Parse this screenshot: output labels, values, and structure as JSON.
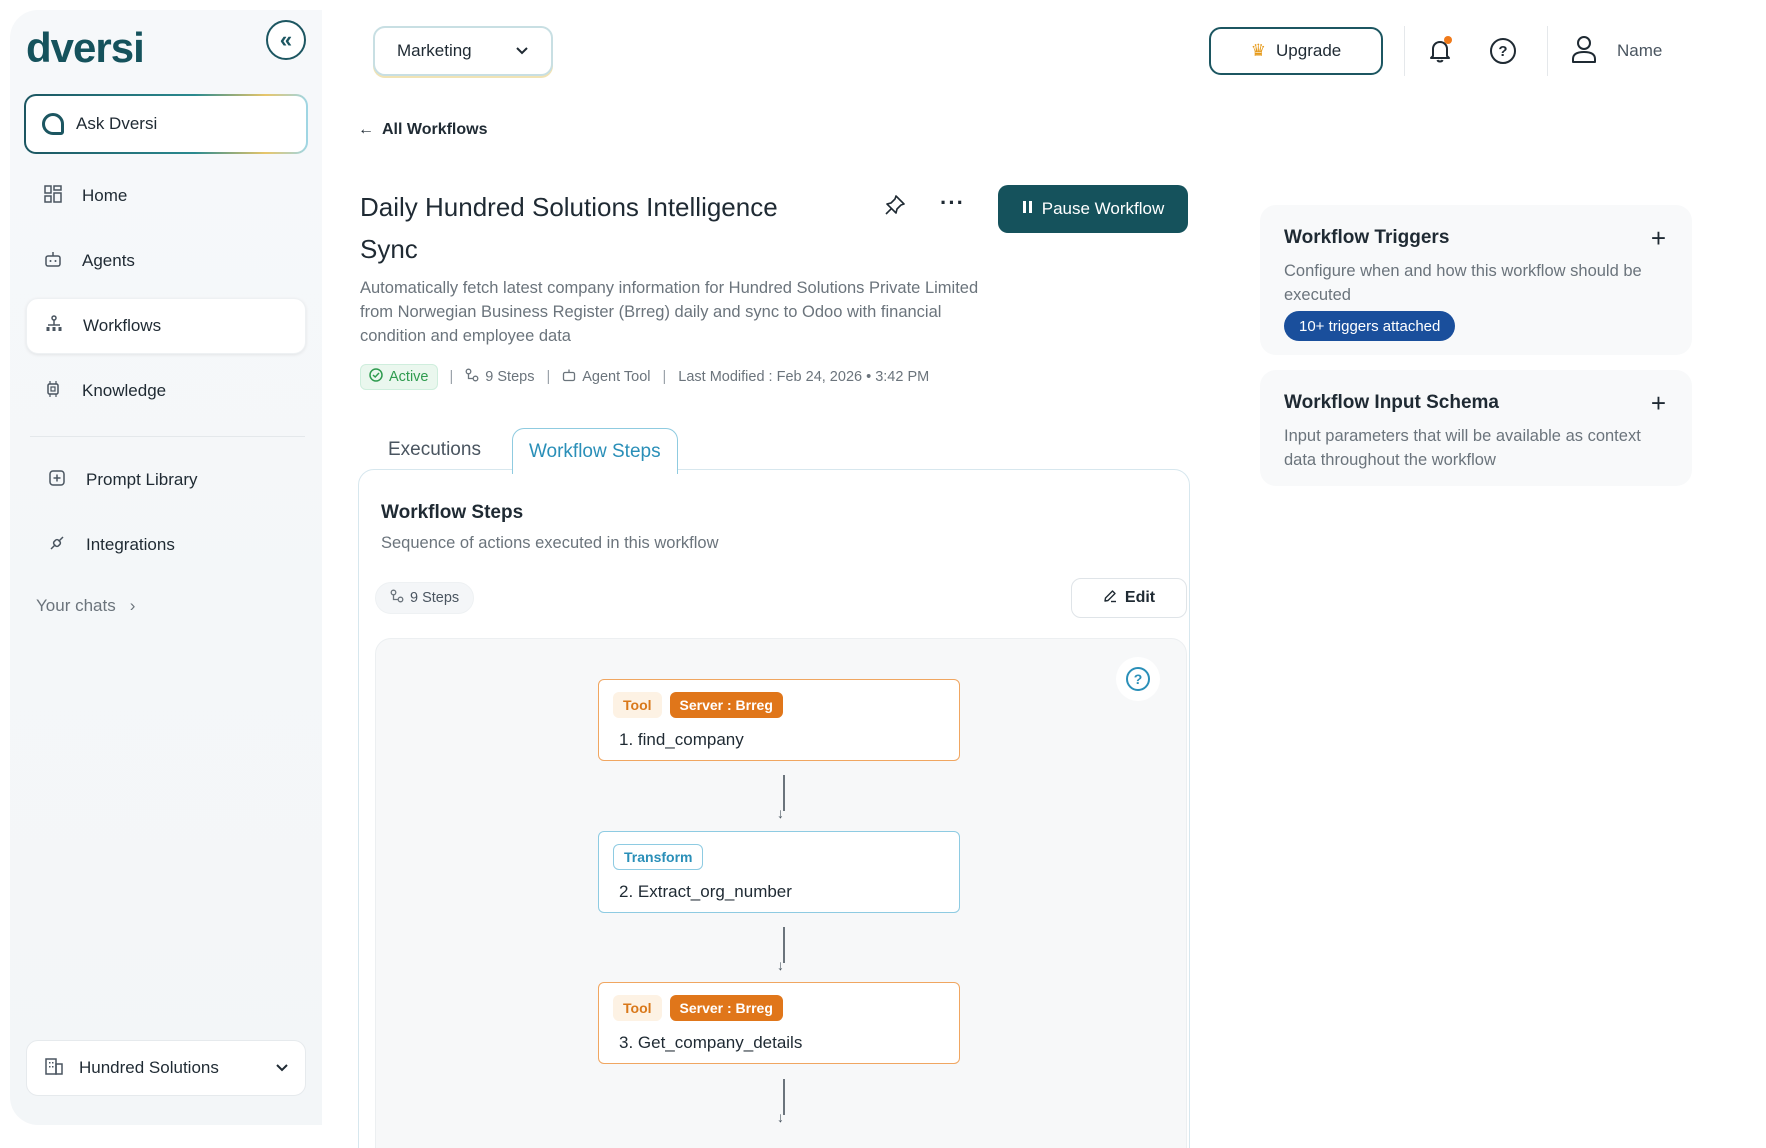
{
  "app": {
    "logo_text": "dversi"
  },
  "sidebar": {
    "ask_label": "Ask Dversi",
    "items": [
      {
        "label": "Home",
        "icon": "grid-icon"
      },
      {
        "label": "Agents",
        "icon": "robot-icon"
      },
      {
        "label": "Workflows",
        "icon": "hierarchy-icon",
        "active": true
      },
      {
        "label": "Knowledge",
        "icon": "chip-icon"
      },
      {
        "label": "Prompt Library",
        "icon": "plus-square-icon"
      },
      {
        "label": "Integrations",
        "icon": "plug-icon"
      }
    ],
    "your_chats_label": "Your chats",
    "org_label": "Hundred Solutions"
  },
  "header": {
    "team_select_value": "Marketing",
    "upgrade_label": "Upgrade",
    "user_name": "Name"
  },
  "workflow": {
    "back_label": "All Workflows",
    "title": "Daily Hundred Solutions Intelligence Sync",
    "pause_label": "Pause Workflow",
    "description": "Automatically fetch latest company information for Hundred Solutions Private Limited from Norwegian Business Register (Brreg) daily and sync to Odoo with financial condition and employee data",
    "status": "Active",
    "steps_meta": "9 Steps",
    "agent_meta": "Agent Tool",
    "last_modified": "Last Modified : Feb 24, 2026 • 3:42 PM",
    "separator": "|"
  },
  "tabs": {
    "executions": "Executions",
    "workflow_steps": "Workflow Steps"
  },
  "steps_panel": {
    "title": "Workflow Steps",
    "subtitle": "Sequence of actions executed in this workflow",
    "count": "9 Steps",
    "edit_label": "Edit",
    "help_glyph": "?",
    "nodes": [
      {
        "type_tag": "Tool",
        "server_tag": "Server : Brreg",
        "label": "1. find_company"
      },
      {
        "type_tag": "Transform",
        "label": "2. Extract_org_number"
      },
      {
        "type_tag": "Tool",
        "server_tag": "Server : Brreg",
        "label": "3. Get_company_details"
      }
    ]
  },
  "triggers_card": {
    "title": "Workflow Triggers",
    "description": "Configure when and how this workflow should be executed",
    "pill": "10+ triggers attached"
  },
  "schema_card": {
    "title": "Workflow Input Schema",
    "description": "Input parameters that will be available as context data throughout the workflow"
  },
  "colors": {
    "brand": "#15525c",
    "accent_blue": "#2a8fb8",
    "tool_orange": "#e0761a",
    "active_green": "#2f9b4f",
    "pill_blue": "#1a4f9c"
  }
}
